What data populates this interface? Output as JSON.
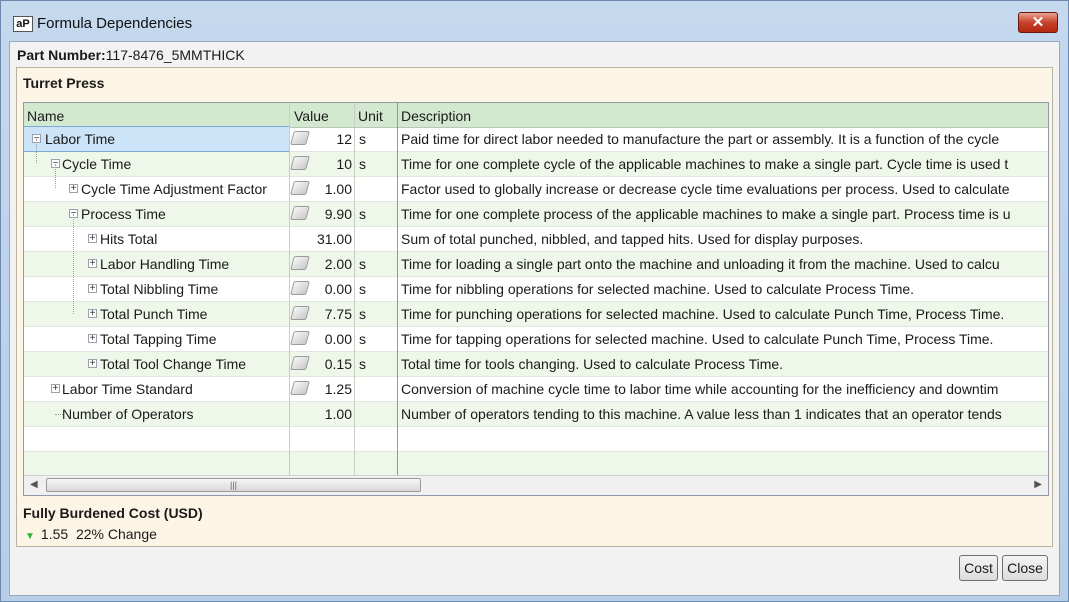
{
  "window": {
    "title": "Formula Dependencies",
    "app_icon": "aP",
    "close_glyph": "✕"
  },
  "part": {
    "label": "Part Number:",
    "value": "117-8476_5MMTHICK"
  },
  "section": {
    "title": "Turret Press"
  },
  "columns": {
    "name": "Name",
    "value": "Value",
    "unit": "Unit",
    "description": "Description"
  },
  "rows": [
    {
      "name": "Labor Time",
      "expander": "−",
      "has_calc": true,
      "value": "12",
      "unit": "s",
      "description": "Paid time for direct labor needed to manufacture the part or assembly. It is a function of the cycle"
    },
    {
      "name": "Cycle Time",
      "expander": "−",
      "has_calc": true,
      "value": "10",
      "unit": "s",
      "description": "Time for one complete cycle of the applicable machines to make a single part. Cycle time is used t"
    },
    {
      "name": "Cycle Time Adjustment Factor",
      "expander": "+",
      "has_calc": true,
      "value": "1.00",
      "unit": "",
      "description": "Factor used to globally increase or decrease cycle time evaluations per process. Used to calculate"
    },
    {
      "name": "Process Time",
      "expander": "−",
      "has_calc": true,
      "value": "9.90",
      "unit": "s",
      "description": "Time for one complete process of the applicable machines to make a single part. Process time is u"
    },
    {
      "name": "Hits Total",
      "expander": "+",
      "has_calc": false,
      "value": "31.00",
      "unit": "",
      "description": "Sum of total punched, nibbled, and tapped hits. Used for display purposes."
    },
    {
      "name": "Labor Handling Time",
      "expander": "+",
      "has_calc": true,
      "value": "2.00",
      "unit": "s",
      "description": "Time for loading a single part onto the machine and unloading it from the machine. Used to calcu"
    },
    {
      "name": "Total Nibbling Time",
      "expander": "+",
      "has_calc": true,
      "value": "0.00",
      "unit": "s",
      "description": "Time for nibbling operations for selected machine. Used to calculate Process Time."
    },
    {
      "name": "Total Punch Time",
      "expander": "+",
      "has_calc": true,
      "value": "7.75",
      "unit": "s",
      "description": "Time for punching operations for selected machine. Used to calculate Punch Time, Process Time."
    },
    {
      "name": "Total Tapping Time",
      "expander": "+",
      "has_calc": true,
      "value": "0.00",
      "unit": "s",
      "description": "Time for tapping operations for selected machine. Used to calculate Punch Time, Process Time."
    },
    {
      "name": "Total Tool Change Time",
      "expander": "+",
      "has_calc": true,
      "value": "0.15",
      "unit": "s",
      "description": "Total time for tools changing. Used to calculate Process Time."
    },
    {
      "name": "Labor Time Standard",
      "expander": "+",
      "has_calc": true,
      "value": "1.25",
      "unit": "",
      "description": "Conversion of machine cycle time to labor time while accounting for the inefficiency and downtim"
    },
    {
      "name": "Number of Operators",
      "expander": "",
      "has_calc": false,
      "value": "1.00",
      "unit": "",
      "description": "Number of operators tending to this machine. A value less than 1 indicates that an operator tends"
    }
  ],
  "scroll": {
    "left": "◀",
    "right": "▶",
    "grip": "|||"
  },
  "cost": {
    "title": "Fully Burdened Cost (USD)",
    "value": "1.55",
    "change": "22% Change",
    "arrow": "▼",
    "arrow_color": "#2bb53c"
  },
  "buttons": {
    "cost": "Cost",
    "close": "Close"
  },
  "colors": {
    "header_bg": "#d2e8cf",
    "panel_bg": "#fcf5e6",
    "titlebar": "#c4d8ee"
  }
}
